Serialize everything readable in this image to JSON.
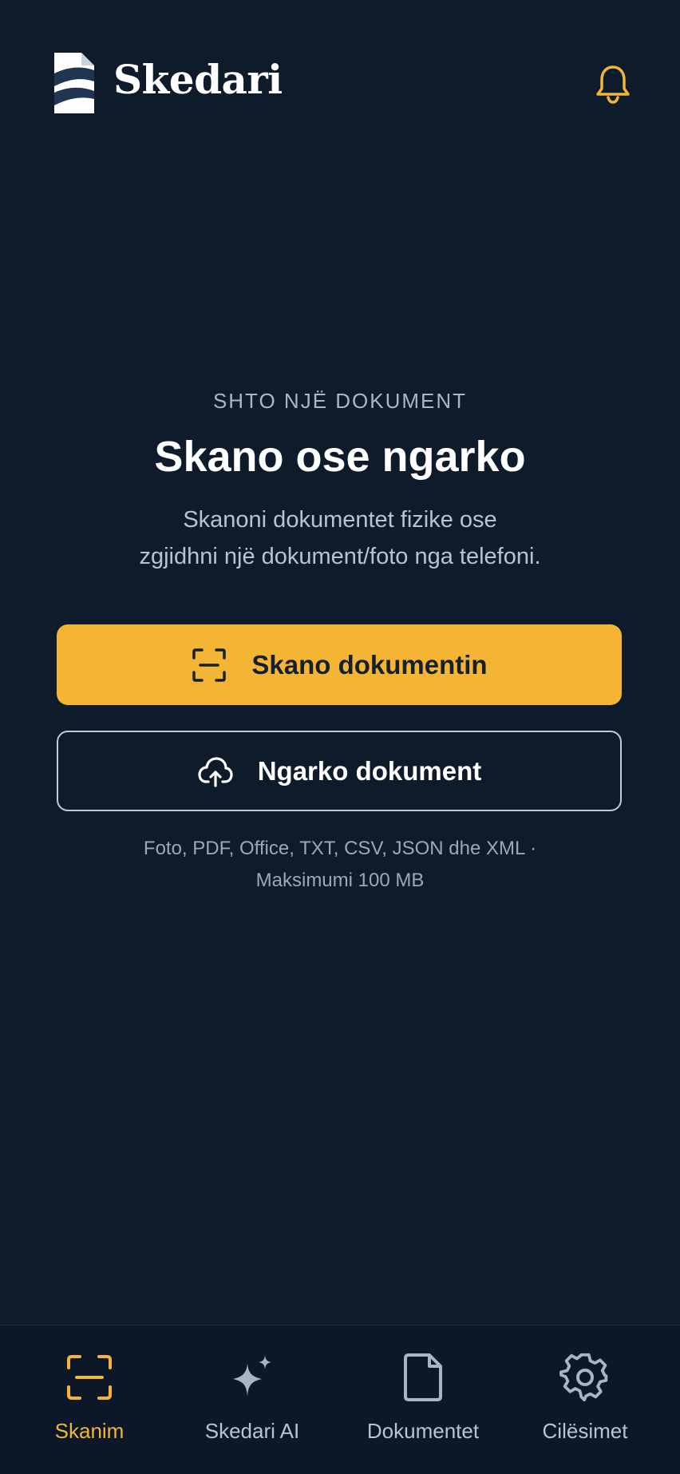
{
  "header": {
    "brand": "Skedari",
    "logo_icon": "skedari-logo",
    "notification_icon": "bell-icon"
  },
  "hero": {
    "eyebrow": "SHTO NJË DOKUMENT",
    "title": "Skano ose ngarko",
    "subtitle_line1": "Skanoni dokumentet fizike ose",
    "subtitle_line2": "zgjidhni një dokument/foto nga telefoni."
  },
  "actions": {
    "scan_label": "Skano dokumentin",
    "upload_label": "Ngarko dokument",
    "formats_line1": "Foto, PDF, Office, TXT, CSV, JSON dhe XML ·",
    "formats_line2": "Maksimumi 100 MB"
  },
  "nav": {
    "items": [
      {
        "label": "Skanim",
        "icon": "scan-icon",
        "active": true
      },
      {
        "label": "Skedari AI",
        "icon": "sparkle-icon",
        "active": false
      },
      {
        "label": "Dokumentet",
        "icon": "document-icon",
        "active": false
      },
      {
        "label": "Cilësimet",
        "icon": "gear-icon",
        "active": false
      }
    ]
  },
  "colors": {
    "background": "#0e1b2b",
    "accent": "#f4b534",
    "text_primary": "#ffffff",
    "text_muted": "#b7c3d2"
  }
}
